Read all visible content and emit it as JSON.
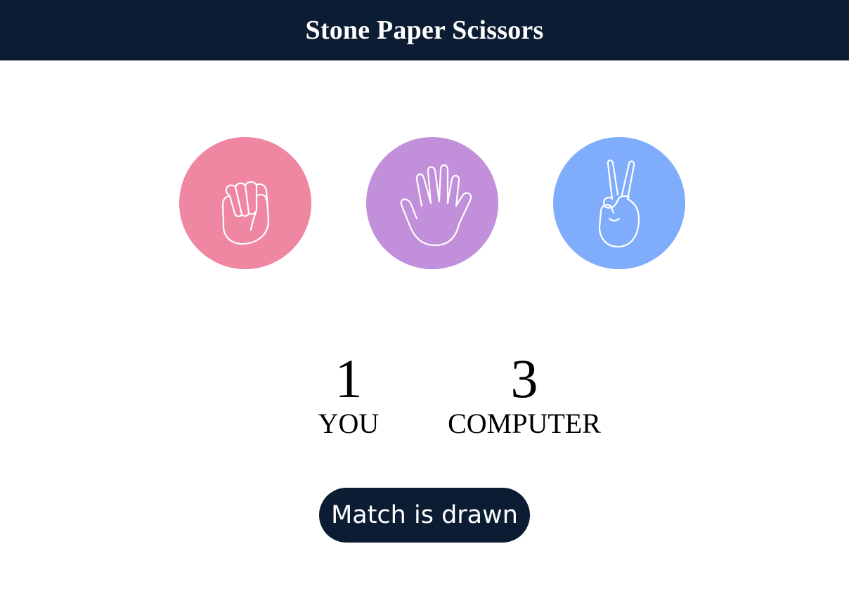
{
  "header": {
    "title": "Stone Paper Scissors"
  },
  "choices": [
    {
      "id": "stone",
      "icon": "fist-icon",
      "color": "#ef86a2"
    },
    {
      "id": "paper",
      "icon": "open-hand-icon",
      "color": "#c28fdb"
    },
    {
      "id": "scissors",
      "icon": "peace-hand-icon",
      "color": "#7fadfb"
    }
  ],
  "scores": {
    "user": {
      "value": "1",
      "label": "YOU"
    },
    "computer": {
      "value": "3",
      "label": "COMPUTER"
    }
  },
  "message": {
    "text": "Match is drawn",
    "background": "#0b1c33"
  },
  "theme": {
    "header_bg": "#0b1c33",
    "header_text": "#ffffff"
  }
}
